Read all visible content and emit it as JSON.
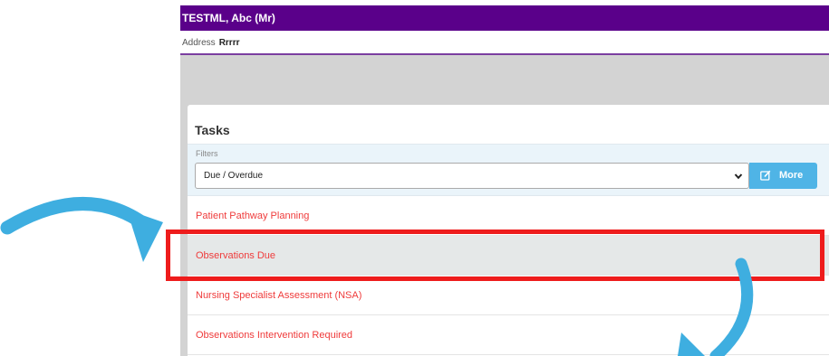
{
  "patient": {
    "name": "TESTML, Abc (Mr)"
  },
  "address": {
    "label": "Address",
    "value": "Rrrrr"
  },
  "tasks_panel": {
    "title": "Tasks",
    "filters_label": "Filters",
    "filter_selected": "Due / Overdue",
    "more_label": "More",
    "items": [
      {
        "label": "Patient Pathway Planning"
      },
      {
        "label": "Observations Due"
      },
      {
        "label": "Nursing Specialist Assessment (NSA)"
      },
      {
        "label": "Observations Intervention Required"
      }
    ],
    "selected_index": 1
  },
  "colors": {
    "banner": "#5a008a",
    "task_text": "#ef3b3b",
    "highlight": "#ee1c1c",
    "more_button": "#4fb4e6",
    "arrow": "#3eaee0"
  },
  "icons": {
    "more_button": "edit-icon",
    "select": "chevron-down-icon",
    "annotations": [
      "curved-arrow-icon",
      "curved-arrow-icon"
    ]
  }
}
